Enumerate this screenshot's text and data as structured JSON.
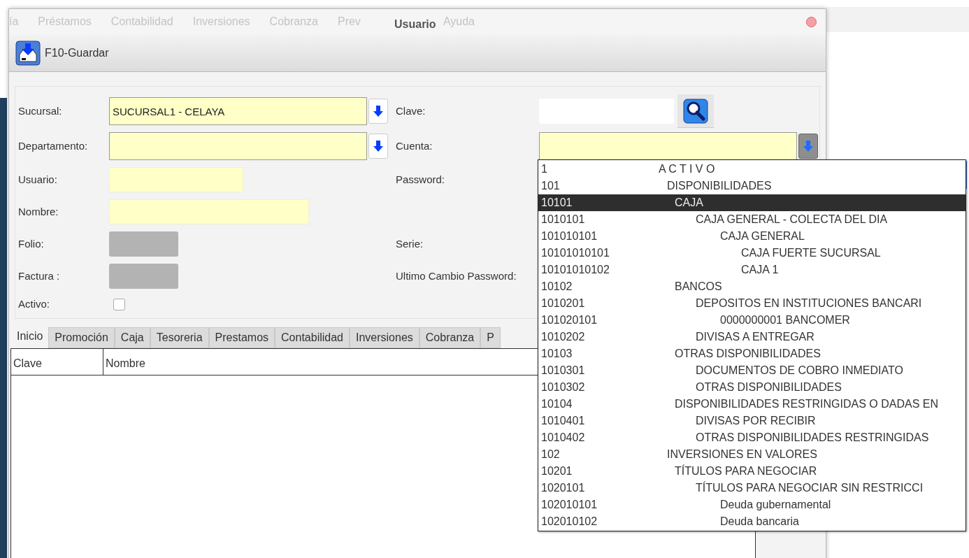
{
  "background_menu": [
    "ía",
    "Préstamos",
    "Contabilidad",
    "Inversiones",
    "Cobranza",
    "Prev",
    "Ayuda"
  ],
  "window": {
    "title": "Usuario"
  },
  "toolbar": {
    "save_button": "F10-Guardar"
  },
  "form": {
    "left": [
      {
        "kind": "combo",
        "label": "Sucursal:",
        "value": "SUCURSAL1 - CELAYA"
      },
      {
        "kind": "combo",
        "label": "Departamento:"
      },
      {
        "kind": "shorttext",
        "label": "Usuario:"
      },
      {
        "kind": "longtext",
        "label": "Nombre:"
      },
      {
        "kind": "readonly",
        "label": "Folio:"
      },
      {
        "kind": "readonly",
        "label": "Factura :"
      },
      {
        "kind": "checkbox",
        "label": "Activo:",
        "checked": false
      }
    ],
    "right": [
      {
        "kind": "search",
        "label": "Clave:"
      },
      {
        "kind": "combo",
        "label": "Cuenta:"
      },
      {
        "kind": "label",
        "label": "Password:"
      },
      {
        "kind": "blank"
      },
      {
        "kind": "label",
        "label": "Serie:"
      },
      {
        "kind": "label",
        "label": "Ultimo Cambio Password:"
      }
    ]
  },
  "tabs": [
    {
      "label": "Inicio",
      "selected": true
    },
    {
      "label": "Promoción",
      "selected": false
    },
    {
      "label": "Caja",
      "selected": false
    },
    {
      "label": "Tesoreria",
      "selected": false
    },
    {
      "label": "Prestamos",
      "selected": false
    },
    {
      "label": "Contabilidad",
      "selected": false
    },
    {
      "label": "Inversiones",
      "selected": false
    },
    {
      "label": "Cobranza",
      "selected": false
    },
    {
      "label": "P",
      "selected": false
    }
  ],
  "table": {
    "columns": [
      "Clave",
      "Nombre"
    ]
  },
  "cuenta_dropdown": [
    {
      "code": "1",
      "name": "A C T I V O",
      "selected": false,
      "children": [
        {
          "code": "101",
          "name": "DISPONIBILIDADES",
          "selected": false,
          "children": [
            {
              "code": "10101",
              "name": "CAJA",
              "selected": true,
              "children": [
                {
                  "code": "1010101",
                  "name": "CAJA GENERAL - COLECTA DEL DIA",
                  "selected": false,
                  "children": [
                    {
                      "code": "101010101",
                      "name": "CAJA GENERAL",
                      "selected": false,
                      "children": [
                        {
                          "code": "10101010101",
                          "name": "CAJA FUERTE SUCURSAL",
                          "selected": false
                        },
                        {
                          "code": "10101010102",
                          "name": "CAJA 1",
                          "selected": false
                        }
                      ]
                    }
                  ]
                }
              ]
            },
            {
              "code": "10102",
              "name": "BANCOS",
              "selected": false,
              "children": [
                {
                  "code": "1010201",
                  "name": "DEPOSITOS EN INSTITUCIONES BANCARI",
                  "selected": false,
                  "children": [
                    {
                      "code": "101020101",
                      "name": "0000000001 BANCOMER",
                      "selected": false
                    }
                  ]
                },
                {
                  "code": "1010202",
                  "name": "DIVISAS A ENTREGAR",
                  "selected": false
                }
              ]
            },
            {
              "code": "10103",
              "name": "OTRAS DISPONIBILIDADES",
              "selected": false,
              "children": [
                {
                  "code": "1010301",
                  "name": "DOCUMENTOS DE COBRO INMEDIATO",
                  "selected": false
                },
                {
                  "code": "1010302",
                  "name": "OTRAS DISPONIBILIDADES",
                  "selected": false
                }
              ]
            },
            {
              "code": "10104",
              "name": "DISPONIBILIDADES RESTRINGIDAS O DADAS EN",
              "selected": false,
              "children": [
                {
                  "code": "1010401",
                  "name": "DIVISAS POR RECIBIR",
                  "selected": false
                },
                {
                  "code": "1010402",
                  "name": "OTRAS DISPONIBILIDADES RESTRINGIDAS",
                  "selected": false
                }
              ]
            }
          ]
        },
        {
          "code": "102",
          "name": "INVERSIONES EN VALORES",
          "selected": false,
          "children": [
            {
              "code": "10201",
              "name": "TÍTULOS PARA NEGOCIAR",
              "selected": false,
              "children": [
                {
                  "code": "1020101",
                  "name": "TÍTULOS PARA NEGOCIAR SIN RESTRICCI",
                  "selected": false,
                  "children": [
                    {
                      "code": "102010101",
                      "name": "Deuda gubernamental",
                      "selected": false
                    },
                    {
                      "code": "102010102",
                      "name": "Deuda bancaria",
                      "selected": false
                    }
                  ]
                }
              ]
            }
          ]
        }
      ]
    }
  ]
}
